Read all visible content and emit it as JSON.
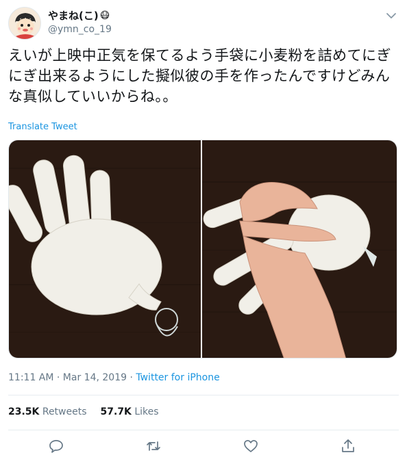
{
  "user": {
    "display_name": "やまね(こ)",
    "emoji": "😷",
    "handle": "@ymn_co_19"
  },
  "tweet": {
    "text": "えいが上映中正気を保てるよう手袋に小麦粉を詰めてにぎにぎ出来るようにした擬似彼の手を作ったんですけどみんな真似していいからね。。",
    "translate_label": "Translate Tweet",
    "time": "11:11 AM · Mar 14, 2019",
    "separator": "·",
    "source": "Twitter for iPhone"
  },
  "stats": {
    "retweets_count": "23.5K",
    "retweets_label": "Retweets",
    "likes_count": "57.7K",
    "likes_label": "Likes"
  },
  "icons": {
    "menu": "chevron-down-icon",
    "reply": "reply-icon",
    "retweet": "retweet-icon",
    "like": "heart-icon",
    "share": "share-icon"
  },
  "colors": {
    "accent": "#1b95e0",
    "muted": "#657786",
    "text": "#14171a",
    "divider": "#e6ecf0"
  }
}
